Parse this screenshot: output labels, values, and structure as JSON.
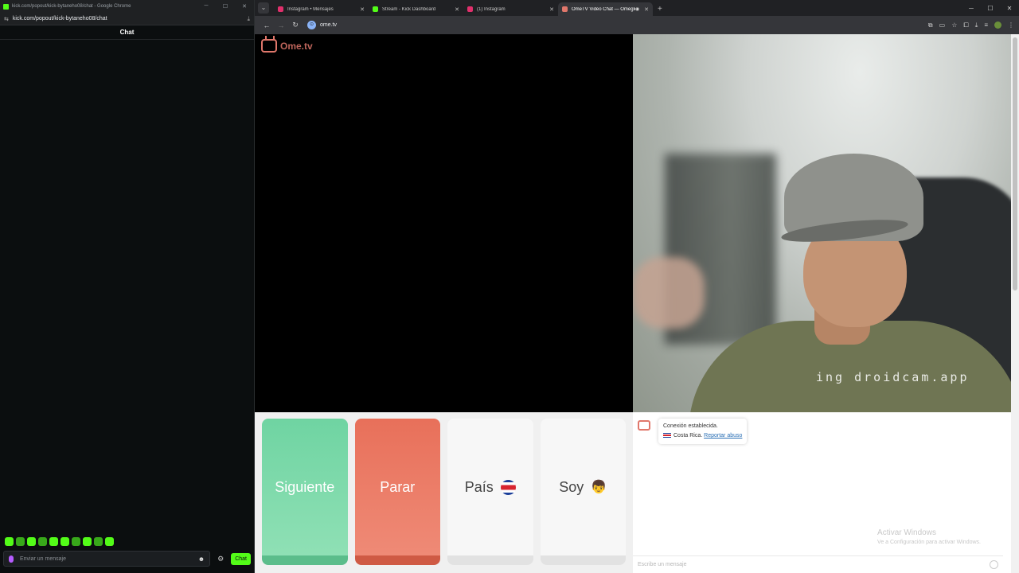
{
  "left_window": {
    "title": "kick.com/popout/kick-bytaneho08/chat - Google Chrome",
    "url": "kick.com/popout/kick-bytaneho08/chat",
    "chat_header": "Chat",
    "input_placeholder": "Enviar un mensaje",
    "send_label": "Chat",
    "accent": "#53fc18"
  },
  "right_window": {
    "tabs": [
      {
        "label": "Instagram • Mensajes",
        "color": "#e1306c",
        "active": false
      },
      {
        "label": "Stream - Kick Dashboard",
        "color": "#53fc18",
        "active": false
      },
      {
        "label": "(1) Instagram",
        "color": "#e1306c",
        "active": false
      },
      {
        "label": "OmeTV Video Chat — Omegle",
        "color": "#e0776b",
        "active": true
      }
    ],
    "url": "ome.tv"
  },
  "page": {
    "logo_text": "Ome.tv",
    "watermark": "ing droidcam.app",
    "controls": {
      "next": "Siguiente",
      "stop": "Parar",
      "country": "País",
      "gender": "Soy"
    },
    "system_message": {
      "line1": "Conexión establecida.",
      "country": "Costa Rica.",
      "report": "Reportar abuso"
    },
    "activate_windows": {
      "line1": "Activar Windows",
      "line2": "Ve a Configuración para activar Windows."
    },
    "message_placeholder": "Escribe un mensaje"
  }
}
